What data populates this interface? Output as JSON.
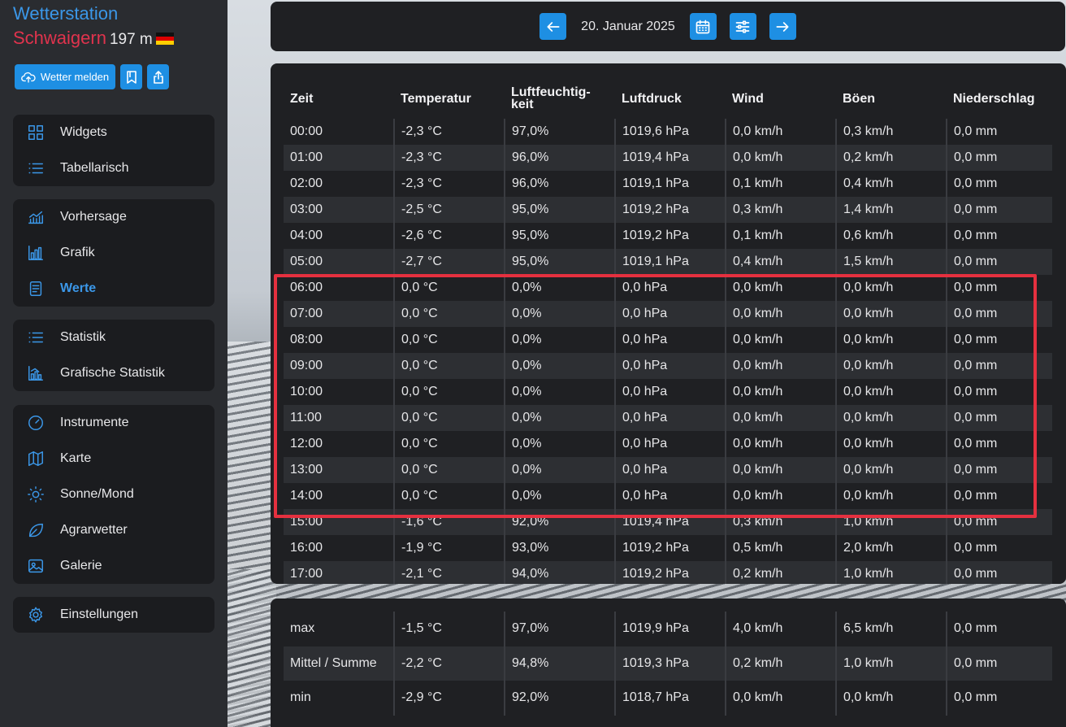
{
  "brand": {
    "title": "Wetterstation",
    "location": "Schwaigern",
    "altitude": "197 m",
    "flag_icon": "germany-flag"
  },
  "actions": {
    "report_label": "Wetter melden"
  },
  "nav": {
    "group1": [
      {
        "label": "Widgets",
        "icon": "grid-icon"
      },
      {
        "label": "Tabellarisch",
        "icon": "list-icon"
      }
    ],
    "group2": [
      {
        "label": "Vorhersage",
        "icon": "forecast-chart-icon"
      },
      {
        "label": "Grafik",
        "icon": "bar-chart-icon"
      },
      {
        "label": "Werte",
        "icon": "document-icon",
        "active": true
      }
    ],
    "group3": [
      {
        "label": "Statistik",
        "icon": "list-icon"
      },
      {
        "label": "Grafische Statistik",
        "icon": "stats-chart-icon"
      }
    ],
    "group4": [
      {
        "label": "Instrumente",
        "icon": "gauge-icon"
      },
      {
        "label": "Karte",
        "icon": "map-icon"
      },
      {
        "label": "Sonne/Mond",
        "icon": "sun-icon"
      },
      {
        "label": "Agrarwetter",
        "icon": "leaf-icon"
      },
      {
        "label": "Galerie",
        "icon": "image-icon"
      }
    ],
    "group5": [
      {
        "label": "Einstellungen",
        "icon": "gear-icon"
      }
    ]
  },
  "topbar": {
    "date": "20. Januar 2025"
  },
  "table": {
    "headers": [
      "Zeit",
      "Temperatur",
      "Luftfeuchtig-keit",
      "Luftdruck",
      "Wind",
      "Böen",
      "Niederschlag"
    ],
    "rows": [
      [
        "00:00",
        "-2,3 °C",
        "97,0%",
        "1019,6 hPa",
        "0,0 km/h",
        "0,3 km/h",
        "0,0 mm"
      ],
      [
        "01:00",
        "-2,3 °C",
        "96,0%",
        "1019,4 hPa",
        "0,0 km/h",
        "0,2 km/h",
        "0,0 mm"
      ],
      [
        "02:00",
        "-2,3 °C",
        "96,0%",
        "1019,1 hPa",
        "0,1 km/h",
        "0,4 km/h",
        "0,0 mm"
      ],
      [
        "03:00",
        "-2,5 °C",
        "95,0%",
        "1019,2 hPa",
        "0,3 km/h",
        "1,4 km/h",
        "0,0 mm"
      ],
      [
        "04:00",
        "-2,6 °C",
        "95,0%",
        "1019,2 hPa",
        "0,1 km/h",
        "0,6 km/h",
        "0,0 mm"
      ],
      [
        "05:00",
        "-2,7 °C",
        "95,0%",
        "1019,1 hPa",
        "0,4 km/h",
        "1,5 km/h",
        "0,0 mm"
      ],
      [
        "06:00",
        "0,0 °C",
        "0,0%",
        "0,0 hPa",
        "0,0 km/h",
        "0,0 km/h",
        "0,0 mm"
      ],
      [
        "07:00",
        "0,0 °C",
        "0,0%",
        "0,0 hPa",
        "0,0 km/h",
        "0,0 km/h",
        "0,0 mm"
      ],
      [
        "08:00",
        "0,0 °C",
        "0,0%",
        "0,0 hPa",
        "0,0 km/h",
        "0,0 km/h",
        "0,0 mm"
      ],
      [
        "09:00",
        "0,0 °C",
        "0,0%",
        "0,0 hPa",
        "0,0 km/h",
        "0,0 km/h",
        "0,0 mm"
      ],
      [
        "10:00",
        "0,0 °C",
        "0,0%",
        "0,0 hPa",
        "0,0 km/h",
        "0,0 km/h",
        "0,0 mm"
      ],
      [
        "11:00",
        "0,0 °C",
        "0,0%",
        "0,0 hPa",
        "0,0 km/h",
        "0,0 km/h",
        "0,0 mm"
      ],
      [
        "12:00",
        "0,0 °C",
        "0,0%",
        "0,0 hPa",
        "0,0 km/h",
        "0,0 km/h",
        "0,0 mm"
      ],
      [
        "13:00",
        "0,0 °C",
        "0,0%",
        "0,0 hPa",
        "0,0 km/h",
        "0,0 km/h",
        "0,0 mm"
      ],
      [
        "14:00",
        "0,0 °C",
        "0,0%",
        "0,0 hPa",
        "0,0 km/h",
        "0,0 km/h",
        "0,0 mm"
      ],
      [
        "15:00",
        "-1,6 °C",
        "92,0%",
        "1019,4 hPa",
        "0,3 km/h",
        "1,0 km/h",
        "0,0 mm"
      ],
      [
        "16:00",
        "-1,9 °C",
        "93,0%",
        "1019,2 hPa",
        "0,5 km/h",
        "2,0 km/h",
        "0,0 mm"
      ],
      [
        "17:00",
        "-2,1 °C",
        "94,0%",
        "1019,2 hPa",
        "0,2 km/h",
        "1,0 km/h",
        "0,0 mm"
      ]
    ]
  },
  "summary": {
    "rows": [
      [
        "max",
        "-1,5 °C",
        "97,0%",
        "1019,9 hPa",
        "4,0 km/h",
        "6,5 km/h",
        "0,0 mm"
      ],
      [
        "Mittel / Summe",
        "-2,2 °C",
        "94,8%",
        "1019,3 hPa",
        "0,2 km/h",
        "1,0 km/h",
        "0,0 mm"
      ],
      [
        "min",
        "-2,9 °C",
        "92,0%",
        "1018,7 hPa",
        "0,0 km/h",
        "0,0 km/h",
        "0,0 mm"
      ]
    ]
  },
  "colors": {
    "accent": "#1e8fe3",
    "location": "#e0334d",
    "highlight": "#e5303f",
    "panel": "#1f2023"
  }
}
